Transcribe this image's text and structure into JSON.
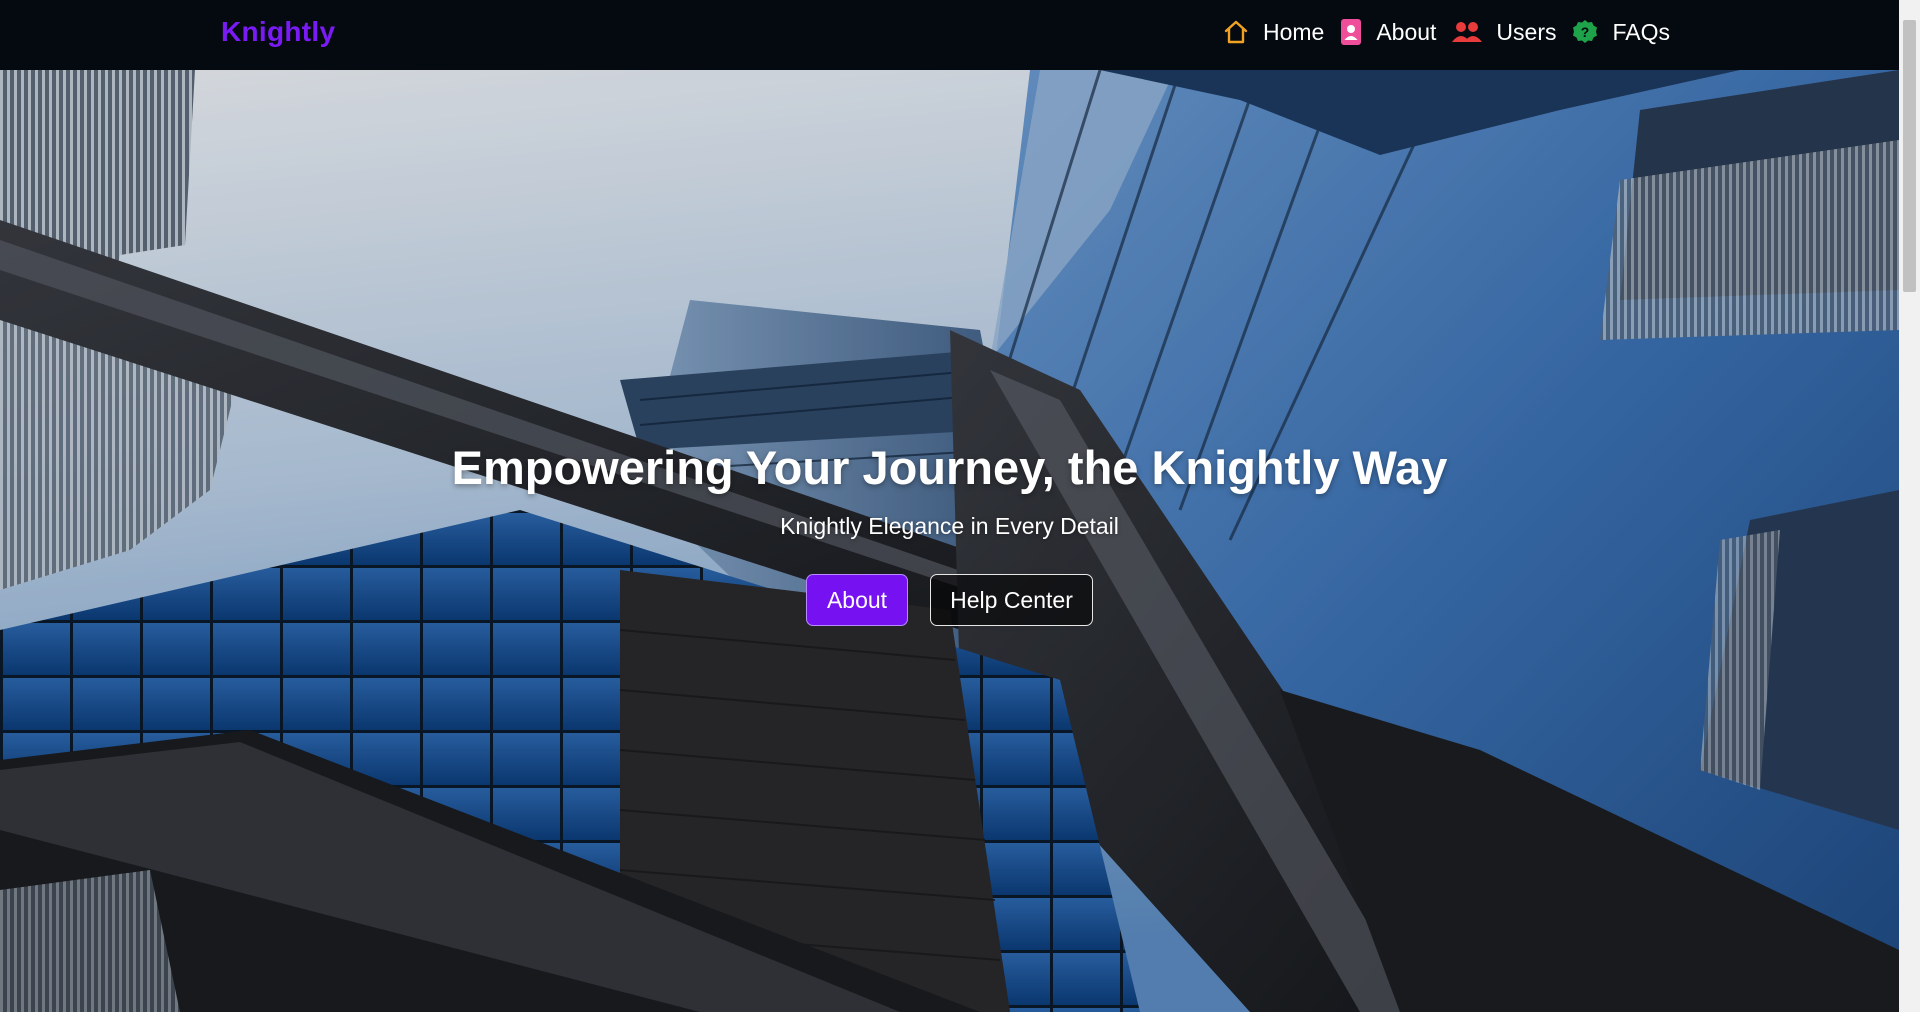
{
  "brand": {
    "name": "Knightly"
  },
  "nav": {
    "items": [
      {
        "label": "Home",
        "icon": "home-icon",
        "color": "#f0a323"
      },
      {
        "label": "About",
        "icon": "id-card-icon",
        "color": "#ef4f9a"
      },
      {
        "label": "Users",
        "icon": "users-icon",
        "color": "#e83b3b"
      },
      {
        "label": "FAQs",
        "icon": "question-circle-icon",
        "color": "#1fa34a"
      }
    ]
  },
  "hero": {
    "title": "Empowering Your Journey, the Knightly Way",
    "subtitle": "Knightly Elegance in Every Detail",
    "primary_button": "About",
    "secondary_button": "Help Center",
    "background": "skyscrapers-photo"
  },
  "colors": {
    "accent": "#7612f2",
    "navbar": "#050a10",
    "text": "#ffffff"
  }
}
